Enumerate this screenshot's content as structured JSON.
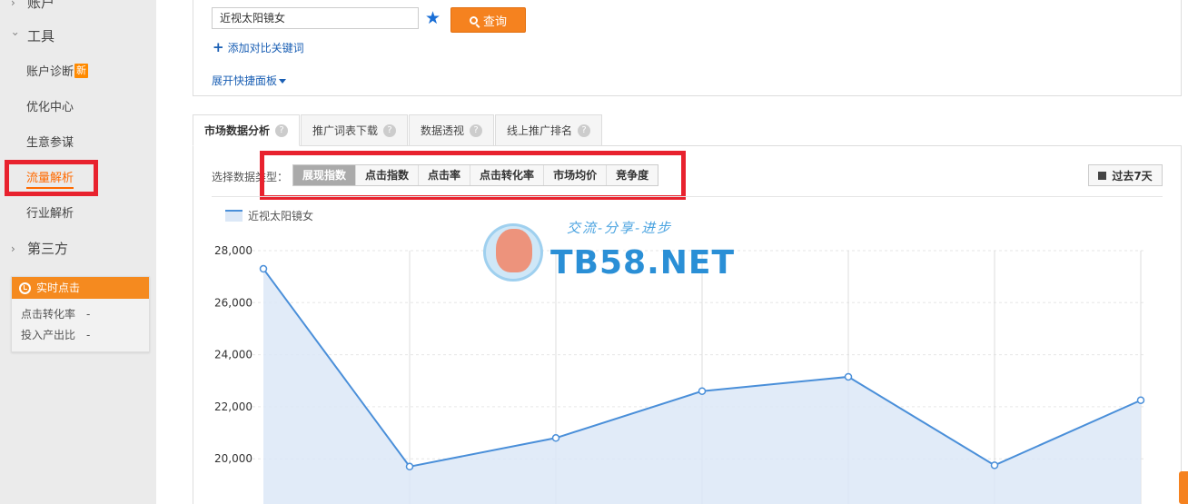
{
  "sidebar": {
    "account_partial": "账户",
    "tools_label": "工具",
    "items": [
      {
        "label": "账户诊断",
        "badge": "新"
      },
      {
        "label": "优化中心"
      },
      {
        "label": "生意参谋"
      },
      {
        "label": "流量解析"
      },
      {
        "label": "行业解析"
      }
    ],
    "third_party_label": "第三方",
    "realtime": {
      "title": "实时点击",
      "rows": [
        {
          "label": "点击转化率",
          "value": "-"
        },
        {
          "label": "投入产出比",
          "value": "-"
        }
      ]
    }
  },
  "search": {
    "keyword": "近视太阳镜女",
    "query_button": "查询",
    "add_compare": "添加对比关键词",
    "expand_panel": "展开快捷面板"
  },
  "tabs": [
    {
      "label": "市场数据分析",
      "active": true
    },
    {
      "label": "推广词表下载"
    },
    {
      "label": "数据透视"
    },
    {
      "label": "线上推广排名"
    }
  ],
  "data_type": {
    "label": "选择数据类型：",
    "options": [
      "展现指数",
      "点击指数",
      "点击率",
      "点击转化率",
      "市场均价",
      "竞争度"
    ],
    "active_index": 0
  },
  "date_range": "过去7天",
  "watermark": {
    "slogan": "交流-分享-进步",
    "site": "TB58.NET"
  },
  "colors": {
    "accent": "#f5821f",
    "link": "#1a5fb4",
    "highlight_box": "#e8222e",
    "series_line": "#4a8fd9",
    "series_fill": "#dce8f7"
  },
  "chart_data": {
    "type": "area",
    "series": [
      {
        "name": "近视太阳镜女",
        "values": [
          27300,
          19700,
          20800,
          22600,
          23150,
          19750,
          22250
        ]
      }
    ],
    "y_ticks": [
      "28,000",
      "26,000",
      "24,000",
      "22,000",
      "20,000"
    ],
    "ylim": [
      18000,
      28000
    ],
    "grid": true,
    "legend": "top-left"
  }
}
